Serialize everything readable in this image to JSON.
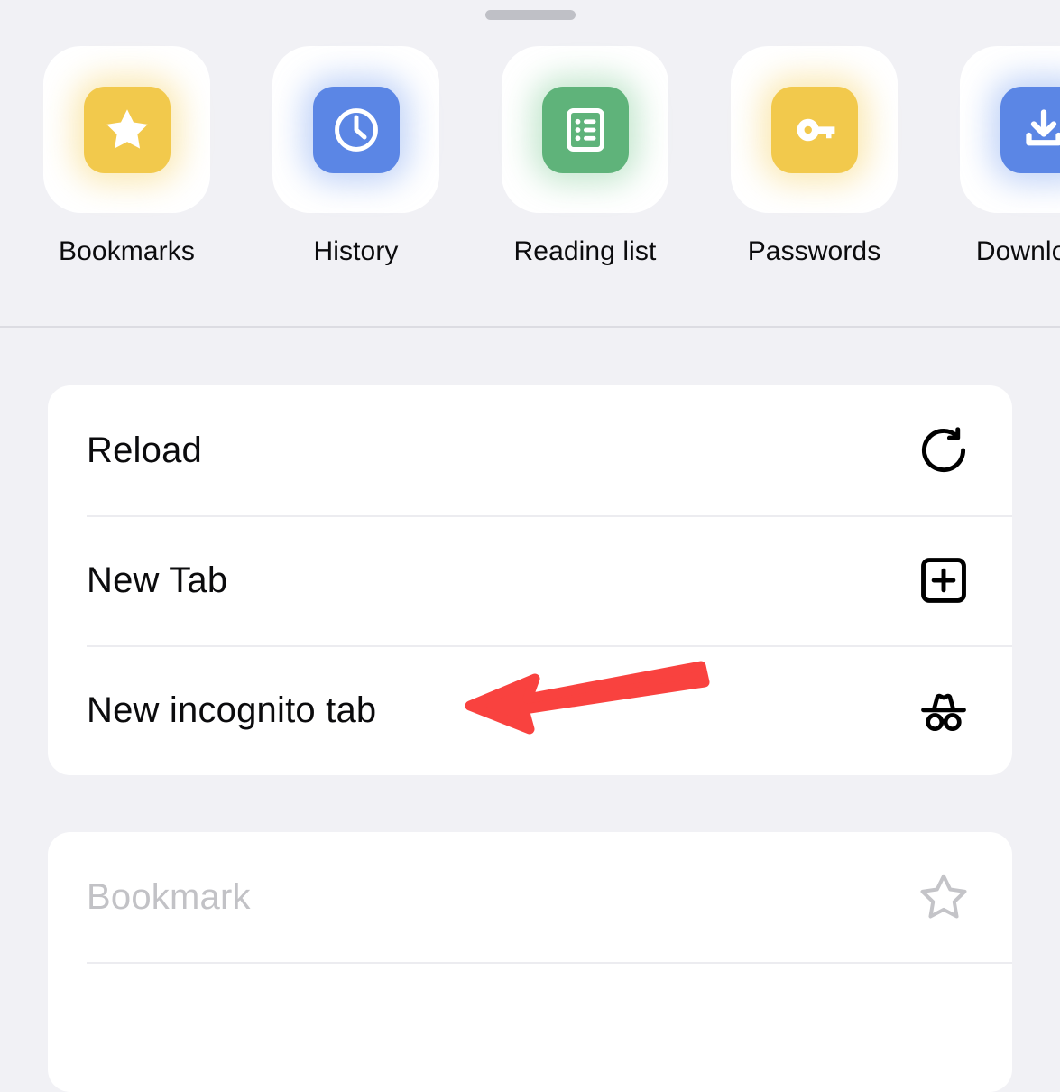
{
  "sheet": {
    "drag_handle": "drag-handle"
  },
  "shortcuts": {
    "items": [
      {
        "label": "Bookmarks",
        "icon": "star-icon",
        "color": "#f2c94c",
        "glow": "#f7d777"
      },
      {
        "label": "History",
        "icon": "clock-icon",
        "color": "#5b86e5",
        "glow": "#8fb0f2"
      },
      {
        "label": "Reading list",
        "icon": "list-page-icon",
        "color": "#5fb37a",
        "glow": "#93d3a6"
      },
      {
        "label": "Passwords",
        "icon": "key-icon",
        "color": "#f2c94c",
        "glow": "#f7d777"
      },
      {
        "label": "Downloads",
        "icon": "download-icon",
        "color": "#5b86e5",
        "glow": "#8fb0f2"
      }
    ]
  },
  "menu": {
    "actions": [
      {
        "label": "Reload",
        "icon": "reload-icon",
        "disabled": false
      },
      {
        "label": "New Tab",
        "icon": "new-tab-icon",
        "disabled": false
      },
      {
        "label": "New incognito tab",
        "icon": "incognito-icon",
        "disabled": false
      }
    ],
    "bookmark_section": [
      {
        "label": "Bookmark",
        "icon": "star-outline-icon",
        "disabled": true
      }
    ]
  },
  "annotation": {
    "name": "red-arrow-pointing-to-new-incognito-tab",
    "color": "#f9423f",
    "points_to": "New incognito tab"
  }
}
